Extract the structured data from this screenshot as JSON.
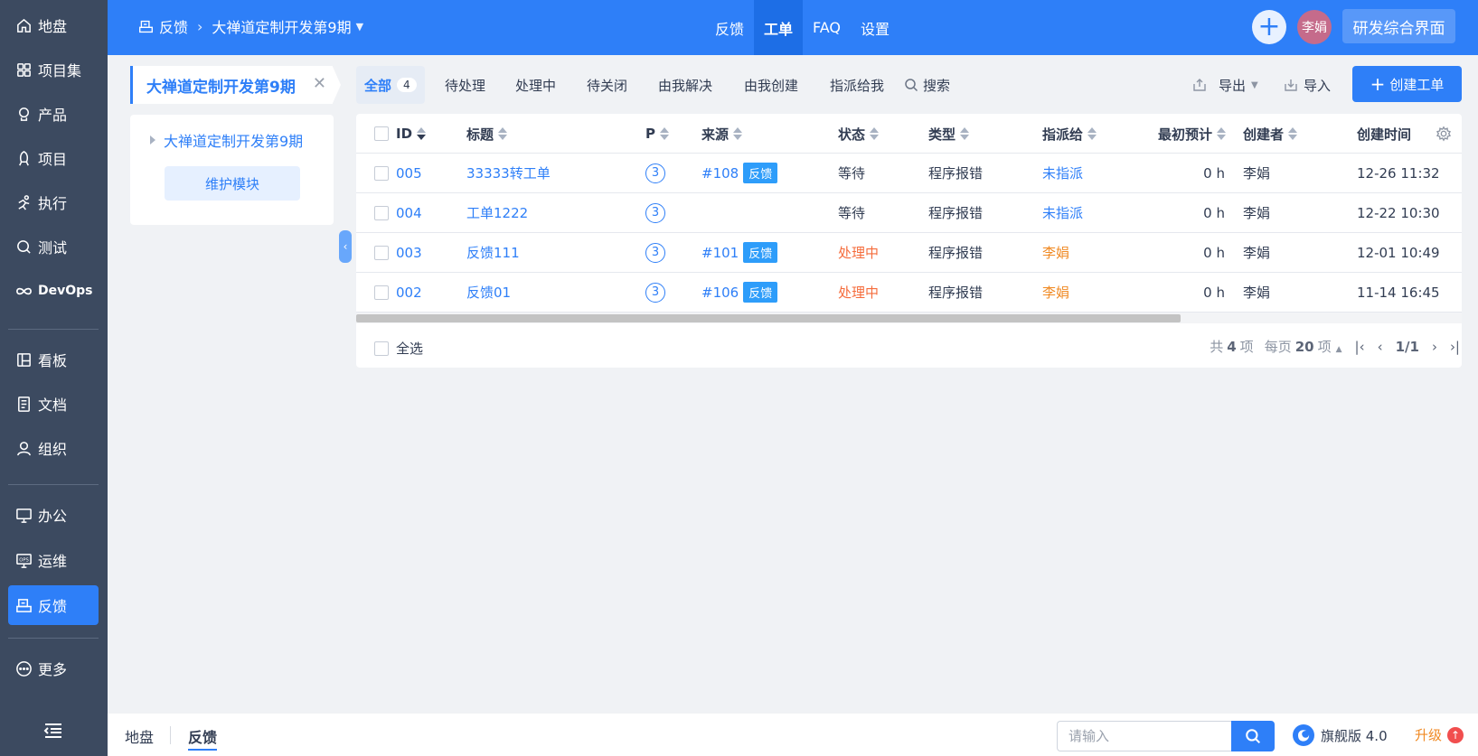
{
  "sidebar": {
    "items": [
      {
        "label": "地盘",
        "icon": "home-icon"
      },
      {
        "label": "项目集",
        "icon": "grid-icon"
      },
      {
        "label": "产品",
        "icon": "product-icon"
      },
      {
        "label": "项目",
        "icon": "project-icon"
      },
      {
        "label": "执行",
        "icon": "run-icon"
      },
      {
        "label": "测试",
        "icon": "test-icon"
      },
      {
        "label": "DevOps",
        "icon": "infinity-icon"
      },
      {
        "label": "看板",
        "icon": "kanban-icon"
      },
      {
        "label": "文档",
        "icon": "doc-icon"
      },
      {
        "label": "组织",
        "icon": "user-icon"
      },
      {
        "label": "办公",
        "icon": "office-icon"
      },
      {
        "label": "运维",
        "icon": "ops-icon"
      },
      {
        "label": "反馈",
        "icon": "feedback-icon",
        "active": true
      },
      {
        "label": "更多",
        "icon": "more-icon"
      }
    ]
  },
  "header": {
    "breadcrumb_root": "反馈",
    "breadcrumb_product": "大禅道定制开发第9期",
    "tabs": [
      "反馈",
      "工单",
      "FAQ",
      "设置"
    ],
    "active_tab": "工单",
    "avatar_text": "李娟",
    "rd_button": "研发综合界面"
  },
  "side_panel": {
    "product_tab": "大禅道定制开发第9期",
    "tree_item": "大禅道定制开发第9期",
    "maintain_button": "维护模块"
  },
  "filters": {
    "all": "全部",
    "all_count": "4",
    "tabs": [
      "待处理",
      "处理中",
      "待关闭",
      "由我解决",
      "由我创建",
      "指派给我"
    ],
    "search": "搜索",
    "export": "导出",
    "import": "导入",
    "create": "创建工单"
  },
  "table": {
    "headers": [
      "ID",
      "标题",
      "P",
      "来源",
      "状态",
      "类型",
      "指派给",
      "最初预计",
      "创建者",
      "创建时间"
    ],
    "rows": [
      {
        "id": "005",
        "title": "33333转工单",
        "pri": "3",
        "source": "#108",
        "source_tag": "反馈",
        "status": "等待",
        "status_kind": "wait",
        "type": "程序报错",
        "assigned": "未指派",
        "assigned_kind": "none",
        "estimate": "0 h",
        "creator": "李娟",
        "created": "12-26 11:32"
      },
      {
        "id": "004",
        "title": "工单1222",
        "pri": "3",
        "source": "",
        "source_tag": "",
        "status": "等待",
        "status_kind": "wait",
        "type": "程序报错",
        "assigned": "未指派",
        "assigned_kind": "none",
        "estimate": "0 h",
        "creator": "李娟",
        "created": "12-22 10:30"
      },
      {
        "id": "003",
        "title": "反馈111",
        "pri": "3",
        "source": "#101",
        "source_tag": "反馈",
        "status": "处理中",
        "status_kind": "doing",
        "type": "程序报错",
        "assigned": "李娟",
        "assigned_kind": "user",
        "estimate": "0 h",
        "creator": "李娟",
        "created": "12-01 10:49"
      },
      {
        "id": "002",
        "title": "反馈01",
        "pri": "3",
        "source": "#106",
        "source_tag": "反馈",
        "status": "处理中",
        "status_kind": "doing",
        "type": "程序报错",
        "assigned": "李娟",
        "assigned_kind": "user",
        "estimate": "0 h",
        "creator": "李娟",
        "created": "11-14 16:45"
      }
    ],
    "select_all": "全选",
    "pager_total_pre": "共",
    "pager_total": "4",
    "pager_total_post": "项",
    "pager_per_pre": "每页",
    "pager_per": "20",
    "pager_per_post": "项",
    "pager_page": "1/1"
  },
  "bottom": {
    "links": [
      "地盘",
      "反馈"
    ],
    "search_placeholder": "请输入",
    "edition": "旗舰版 4.0",
    "upgrade": "升级"
  },
  "colors": {
    "primary": "#2e7ff8",
    "sidebar": "#3c4a60",
    "doing": "#f56c3c",
    "assignee": "#f08a24"
  }
}
